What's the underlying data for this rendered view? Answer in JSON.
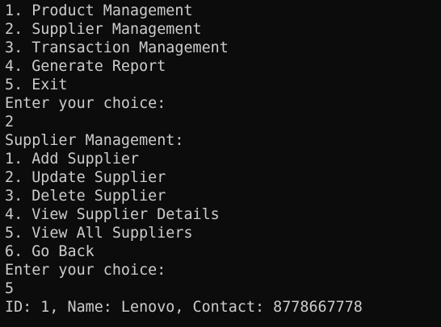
{
  "terminal": {
    "background": "#0c0c0c",
    "foreground": "#cccccc",
    "lines": [
      "1. Product Management",
      "2. Supplier Management",
      "3. Transaction Management",
      "4. Generate Report",
      "5. Exit",
      "Enter your choice:",
      "2",
      "Supplier Management:",
      "1. Add Supplier",
      "2. Update Supplier",
      "3. Delete Supplier",
      "4. View Supplier Details",
      "5. View All Suppliers",
      "6. Go Back",
      "Enter your choice:",
      "5",
      "ID: 1, Name: Lenovo, Contact: 8778667778"
    ]
  }
}
